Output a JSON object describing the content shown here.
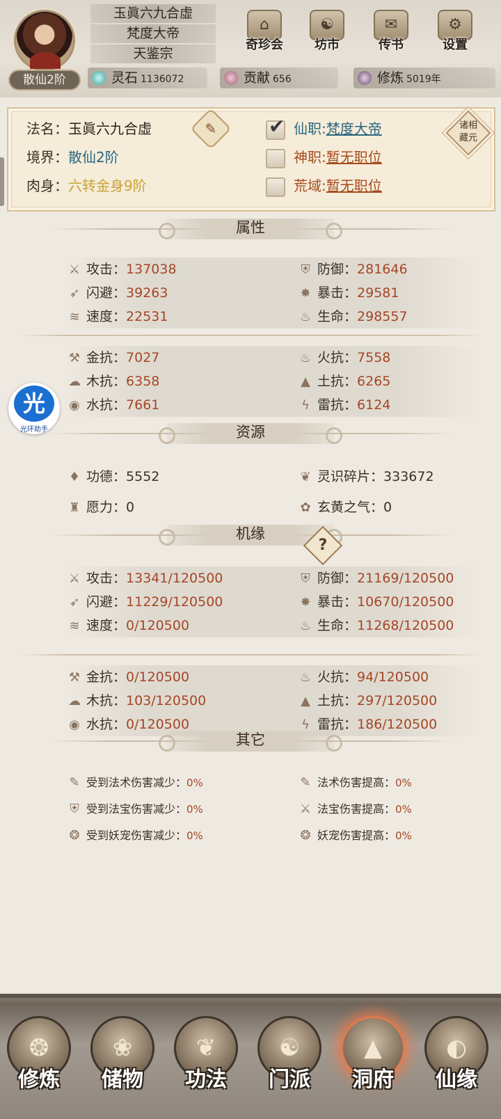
{
  "header": {
    "realm_badge": "散仙2阶",
    "name": "玉眞六九合虛",
    "post": "梵度大帝",
    "sect": "天鉴宗",
    "top_buttons": [
      {
        "label": "奇珍会",
        "icon": "treasure-house-icon"
      },
      {
        "label": "坊市",
        "icon": "market-icon"
      },
      {
        "label": "传书",
        "icon": "scroll-icon"
      },
      {
        "label": "设置",
        "icon": "gear-icon"
      }
    ],
    "resources": {
      "lingshi": {
        "label": "灵石",
        "value": "1136072"
      },
      "gongxian": {
        "label": "贡献",
        "value": "656"
      },
      "xiulian": {
        "label": "修炼",
        "value": "5019年"
      }
    }
  },
  "info": {
    "faming": {
      "key": "法名：",
      "value": "玉眞六九合虛"
    },
    "jingjie": {
      "key": "境界：",
      "value": "散仙2阶"
    },
    "roushen": {
      "key": "肉身：",
      "value": "六转金身9阶"
    },
    "xianzhi": {
      "key": "仙职:",
      "value": "梵度大帝",
      "checked": true
    },
    "shenzhi": {
      "key": "神职:",
      "value": "暂无职位",
      "checked": false
    },
    "huangyu": {
      "key": "荒域:",
      "value": "暂无职位",
      "checked": false
    },
    "zhuxiang": "诸相藏元"
  },
  "sections": {
    "shuxing": "属性",
    "ziyuan": "资源",
    "jiyuan": "机缘",
    "qita": "其它"
  },
  "shuxing": [
    [
      {
        "k": "攻击：",
        "v": "137038"
      },
      {
        "k": "防御：",
        "v": "281646"
      }
    ],
    [
      {
        "k": "闪避：",
        "v": "39263"
      },
      {
        "k": "暴击：",
        "v": "29581"
      }
    ],
    [
      {
        "k": "速度：",
        "v": "22531"
      },
      {
        "k": "生命：",
        "v": "298557"
      }
    ]
  ],
  "kang": [
    [
      {
        "k": "金抗：",
        "v": "7027"
      },
      {
        "k": "火抗：",
        "v": "7558"
      }
    ],
    [
      {
        "k": "木抗：",
        "v": "6358"
      },
      {
        "k": "土抗：",
        "v": "6265"
      }
    ],
    [
      {
        "k": "水抗：",
        "v": "7661"
      },
      {
        "k": "雷抗：",
        "v": "6124"
      }
    ]
  ],
  "ziyuan": [
    [
      {
        "k": "功德：",
        "v": "5552"
      },
      {
        "k": "灵识碎片：",
        "v": "333672"
      }
    ],
    [
      {
        "k": "愿力：",
        "v": "0"
      },
      {
        "k": "玄黄之气：",
        "v": "0"
      }
    ]
  ],
  "jiyuan": [
    [
      {
        "k": "攻击：",
        "v": "13341/120500"
      },
      {
        "k": "防御：",
        "v": "21169/120500"
      }
    ],
    [
      {
        "k": "闪避：",
        "v": "11229/120500"
      },
      {
        "k": "暴击：",
        "v": "10670/120500"
      }
    ],
    [
      {
        "k": "速度：",
        "v": "0/120500"
      },
      {
        "k": "生命：",
        "v": "11268/120500"
      }
    ]
  ],
  "jkang": [
    [
      {
        "k": "金抗：",
        "v": "0/120500"
      },
      {
        "k": "火抗：",
        "v": "94/120500"
      }
    ],
    [
      {
        "k": "木抗：",
        "v": "103/120500"
      },
      {
        "k": "土抗：",
        "v": "297/120500"
      }
    ],
    [
      {
        "k": "水抗：",
        "v": "0/120500"
      },
      {
        "k": "雷抗：",
        "v": "186/120500"
      }
    ]
  ],
  "qita": [
    [
      {
        "k": "受到法术伤害减少：",
        "v": "0%"
      },
      {
        "k": "法术伤害提高：",
        "v": "0%"
      }
    ],
    [
      {
        "k": "受到法宝伤害减少：",
        "v": "0%"
      },
      {
        "k": "法宝伤害提高：",
        "v": "0%"
      }
    ],
    [
      {
        "k": "受到妖宠伤害减少：",
        "v": "0%"
      },
      {
        "k": "妖宠伤害提高：",
        "v": "0%"
      }
    ]
  ],
  "helper": {
    "glyph": "光",
    "caption": "光环助手"
  },
  "bottom_nav": [
    {
      "label": "修炼",
      "icon": "cultivate-icon",
      "active": false
    },
    {
      "label": "储物",
      "icon": "storage-bag-icon",
      "active": false
    },
    {
      "label": "功法",
      "icon": "technique-scroll-icon",
      "active": false
    },
    {
      "label": "门派",
      "icon": "sect-gate-icon",
      "active": false
    },
    {
      "label": "洞府",
      "icon": "cave-dwelling-icon",
      "active": true
    },
    {
      "label": "仙缘",
      "icon": "immortal-fate-icon",
      "active": false
    }
  ]
}
